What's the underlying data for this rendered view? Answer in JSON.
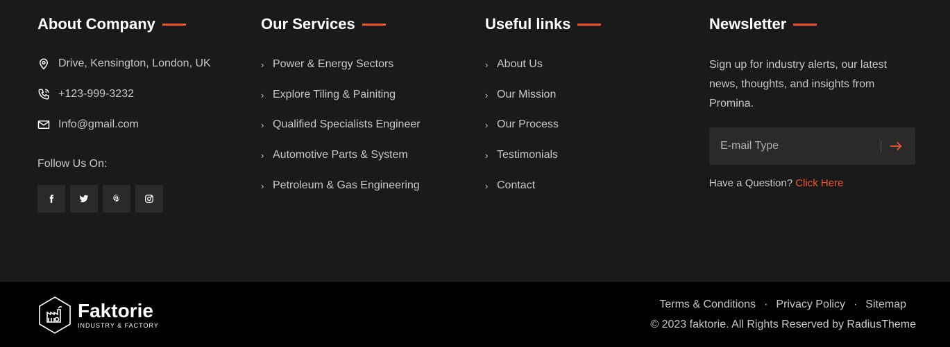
{
  "about": {
    "title": "About Company",
    "address": "Drive, Kensington, London, UK",
    "phone": "+123-999-3232",
    "email": "Info@gmail.com",
    "follow_label": "Follow Us On:",
    "socials": [
      "facebook-icon",
      "twitter-icon",
      "pinterest-icon",
      "instagram-icon"
    ]
  },
  "services": {
    "title": "Our Services",
    "items": [
      "Power & Energy Sectors",
      "Explore Tiling & Painiting",
      "Qualified Specialists Engineer",
      "Automotive Parts & System",
      "Petroleum & Gas Engineering"
    ]
  },
  "useful": {
    "title": "Useful links",
    "items": [
      "About Us",
      "Our Mission",
      "Our Process",
      "Testimonials",
      "Contact"
    ]
  },
  "newsletter": {
    "title": "Newsletter",
    "text": "Sign up for industry alerts, our latest news, thoughts, and insights from Promina.",
    "placeholder": "E-mail Type",
    "question": "Have a Question?",
    "click_here": "Click Here"
  },
  "bottom": {
    "logo_name": "Faktorie",
    "logo_tag": "INDUSTRY & FACTORY",
    "links": [
      "Terms & Conditions",
      "Privacy Policy",
      "Sitemap"
    ],
    "copyright": "© 2023 faktorie. All Rights Reserved by RadiusTheme"
  },
  "colors": {
    "accent": "#f2542d",
    "background": "#1a1a1a",
    "bottom_background": "#000000"
  }
}
